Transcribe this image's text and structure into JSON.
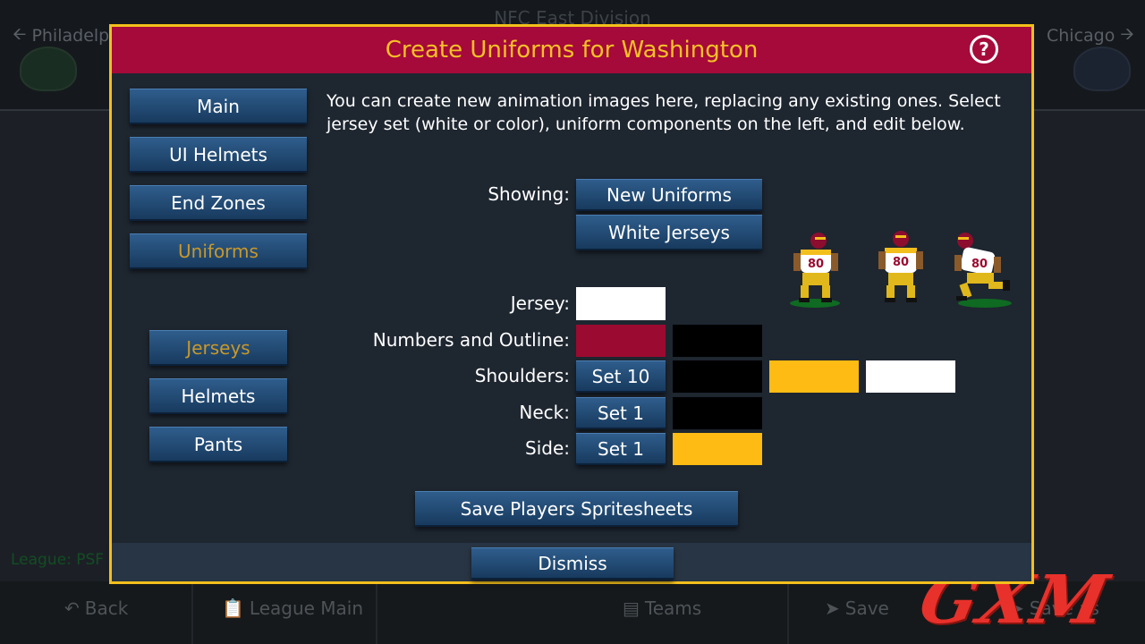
{
  "background": {
    "division_title": "NFC East Division",
    "team_left": "Philadelp",
    "team_right": "Chicago",
    "league_label": "League: PSF",
    "nav": {
      "back": "Back",
      "league_main": "League Main",
      "teams": "Teams",
      "save": "Save",
      "save_as": "Save as"
    }
  },
  "watermark": "GXM",
  "dialog": {
    "title": "Create Uniforms for Washington",
    "help_label": "?",
    "description": "You can create new animation images here, replacing any existing ones. Select jersey set (white or color), uniform components on the left, and edit below.",
    "menu": {
      "main": "Main",
      "ui_helmets": "UI Helmets",
      "end_zones": "End Zones",
      "uniforms": "Uniforms"
    },
    "components": {
      "jerseys": "Jerseys",
      "helmets": "Helmets",
      "pants": "Pants"
    },
    "showing_label": "Showing:",
    "showing_mode": "New Uniforms",
    "jersey_set": "White Jerseys",
    "rows": {
      "jersey": {
        "label": "Jersey:",
        "color": "#ffffff"
      },
      "numbers": {
        "label": "Numbers and Outline:",
        "colors": [
          "#9b0a30",
          "#000000"
        ]
      },
      "shoulders": {
        "label": "Shoulders:",
        "set": "Set 10",
        "colors": [
          "#000000",
          "#fdbb13",
          "#ffffff"
        ]
      },
      "neck": {
        "label": "Neck:",
        "set": "Set 1",
        "colors": [
          "#000000"
        ]
      },
      "side": {
        "label": "Side:",
        "set": "Set 1",
        "colors": [
          "#fdbb13"
        ]
      }
    },
    "save_button": "Save Players Spritesheets",
    "dismiss_button": "Dismiss",
    "player_number": "80"
  },
  "colors": {
    "border": "#f3bf1c",
    "header": "#a50a3a",
    "title": "#f5c027",
    "active_text": "#c8982a"
  }
}
